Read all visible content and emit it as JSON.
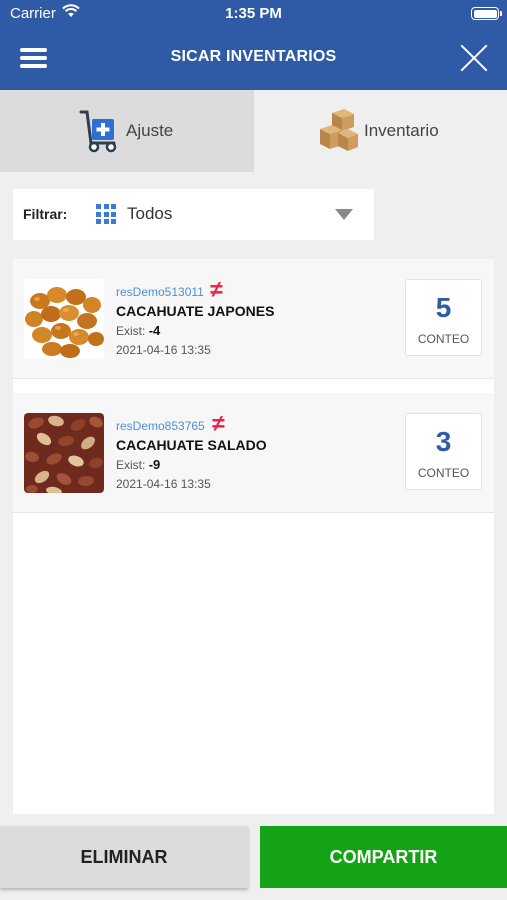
{
  "status_bar": {
    "carrier": "Carrier",
    "time": "1:35 PM"
  },
  "header": {
    "title": "SICAR INVENTARIOS"
  },
  "tabs": [
    {
      "label": "Ajuste",
      "icon": "hand-truck-plus-icon"
    },
    {
      "label": "Inventario",
      "icon": "boxes-icon"
    }
  ],
  "filter": {
    "label": "Filtrar:",
    "value": "Todos",
    "icon": "grid-icon"
  },
  "items": [
    {
      "code": "resDemo513011",
      "status_symbol": "≠",
      "name": "CACAHUATE JAPONES",
      "exist_label": "Exist:",
      "exist_value": "-4",
      "date": "2021-04-16 13:35",
      "count": "5",
      "count_label": "CONTEO",
      "image": "japanese-peanuts"
    },
    {
      "code": "resDemo853765",
      "status_symbol": "≠",
      "name": "CACAHUATE SALADO",
      "exist_label": "Exist:",
      "exist_value": "-9",
      "date": "2021-04-16 13:35",
      "count": "3",
      "count_label": "CONTEO",
      "image": "salted-peanuts"
    }
  ],
  "actions": {
    "delete_label": "ELIMINAR",
    "share_label": "COMPARTIR"
  },
  "colors": {
    "header": "#2f5aa5",
    "accent_blue": "#2f5aa5",
    "share_green": "#13a314",
    "not_equal_red": "#e8244a",
    "code_blue": "#4a90d9"
  }
}
